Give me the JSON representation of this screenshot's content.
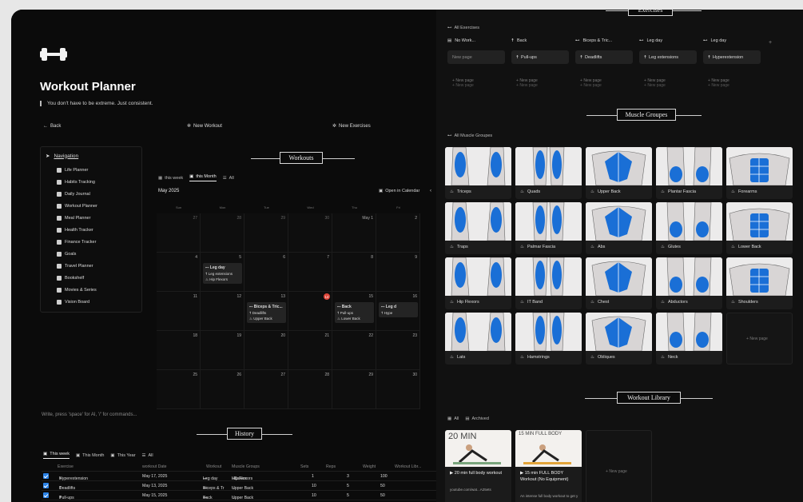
{
  "header": {
    "title": "Workout Planner",
    "quote": "You don't have to be extreme. Just consistent.",
    "back_label": "Back",
    "new_workout_label": "New Workout",
    "new_exercises_label": "New Exercises"
  },
  "navigation": {
    "title": "Navigation",
    "items": [
      "Life Planner",
      "Habits Tracking",
      "Daily Journal",
      "Workout Planner",
      "Meal Planner",
      "Health Tracker",
      "Finance Tracker",
      "Goals",
      "Travel Planner",
      "Bookshelf",
      "Movies & Series",
      "Vision Board"
    ]
  },
  "workouts": {
    "section_title": "Workouts",
    "tabs": [
      "this week",
      "this Month",
      "All"
    ],
    "month": "May 2025",
    "open_calendar": "Open in Calendar",
    "weekdays": [
      "Sun",
      "Mon",
      "Tue",
      "Wed",
      "Thu",
      "Fri"
    ],
    "weeks": [
      [
        "27",
        "28",
        "29",
        "30",
        "May 1",
        "2"
      ],
      [
        "4",
        "5",
        "6",
        "7",
        "8",
        "9"
      ],
      [
        "11",
        "12",
        "13",
        "14",
        "15",
        "16"
      ],
      [
        "18",
        "19",
        "20",
        "21",
        "22",
        "23"
      ],
      [
        "25",
        "26",
        "27",
        "28",
        "29",
        "30"
      ]
    ],
    "events": [
      {
        "title": "Leg day",
        "l1": "Leg extensions",
        "l2": "Hip Flexors",
        "l3": "Ca"
      },
      {
        "title": "Biceps & Tric...",
        "l1": "Deadlifts",
        "l2": "Upper Back"
      },
      {
        "title": "Back",
        "l1": "Pull-ups",
        "l2": "Lower Back"
      },
      {
        "title": "Leg d",
        "l1": "Hype"
      }
    ]
  },
  "editor_placeholder": "Write, press 'space' for AI, '/' for commands...",
  "history": {
    "section_title": "History",
    "tabs": [
      "This week",
      "This Month",
      "This Year",
      "All"
    ],
    "columns": [
      "Exercise",
      "workout Date",
      "Workout",
      "Muscle Groups",
      "Sets",
      "Reps",
      "Weight",
      "Workout Libr..."
    ],
    "rows": [
      {
        "exercise": "Hyperextension",
        "date": "May 17, 2025",
        "workout": "Leg day",
        "muscle1": "Hip Flexors",
        "muscle2": "Calves",
        "sets": "1",
        "reps": "3",
        "weight": "100"
      },
      {
        "exercise": "Deadlifts",
        "date": "May 13, 2025",
        "workout": "Biceps & Tr",
        "muscle1": "Upper Back",
        "muscle2": "",
        "sets": "10",
        "reps": "5",
        "weight": "50"
      },
      {
        "exercise": "Pull-ups",
        "date": "May 15, 2025",
        "workout": "Back",
        "muscle1": "Upper Back",
        "muscle2": "",
        "sets": "10",
        "reps": "5",
        "weight": "50"
      }
    ]
  },
  "exercises": {
    "section_title": "Exercises",
    "tab": "All Exercises",
    "columns": [
      {
        "name": "No Work...",
        "card": "",
        "new_page": "New page"
      },
      {
        "name": "Back",
        "card": "Pull-ups",
        "new_page": "New page"
      },
      {
        "name": "Biceps & Tric...",
        "card": "Deadlifts",
        "new_page": "New page"
      },
      {
        "name": "Leg day",
        "card": "Leg extensions",
        "new_page": "New page"
      },
      {
        "name": "Leg day",
        "card": "Hyperextension",
        "new_page": "New page"
      }
    ],
    "card_new_page": "New page",
    "add_symbol": "+"
  },
  "muscle_groups": {
    "section_title": "Muscle Groupes",
    "tab": "All Muscle Groupes",
    "items": [
      "Triceps",
      "Quads",
      "Upper Back",
      "Plantar Fascia",
      "Forearms",
      "Traps",
      "Palmar Fascia",
      "Abs",
      "Glutes",
      "Lower Back",
      "Hip Flexors",
      "IT Band",
      "Chest",
      "Abductors",
      "Shoulders",
      "Lats",
      "Hamstrings",
      "Obliques",
      "Neck"
    ],
    "new_page": "New page"
  },
  "workout_library": {
    "section_title": "Workout Library",
    "tabs": [
      "All",
      "Archived"
    ],
    "cards": [
      {
        "thumb": "20 MIN",
        "title": "20 min full body workout",
        "sub": "youtube.com/wat...A25ets"
      },
      {
        "thumb": "15 MIN FULL BODY",
        "title": "15 min FULL BODY Workout (No Equipment)",
        "sub": "An intense full body workout to get y"
      }
    ],
    "new_page": "New page"
  },
  "colors": {
    "accent_blue": "#2b83e8",
    "today_red": "#e0463a",
    "muscle_blue": "#1a6fd6"
  }
}
